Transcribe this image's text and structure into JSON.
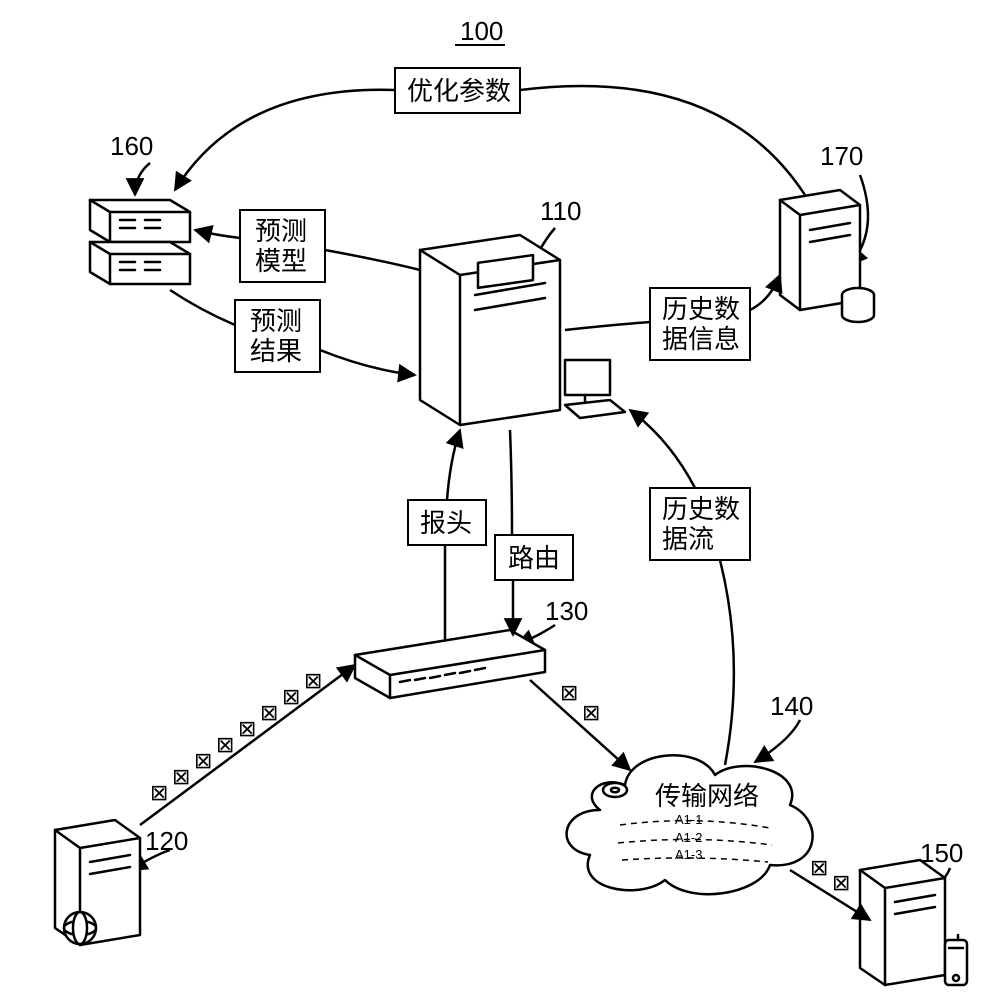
{
  "figure_id": "100",
  "nodes": {
    "n110": {
      "ref": "110"
    },
    "n120": {
      "ref": "120"
    },
    "n130": {
      "ref": "130"
    },
    "n140": {
      "ref": "140",
      "label": "传输网络"
    },
    "n150": {
      "ref": "150"
    },
    "n160": {
      "ref": "160"
    },
    "n170": {
      "ref": "170"
    }
  },
  "edges": {
    "opt_params": {
      "label_l1": "优化参数"
    },
    "pred_model": {
      "label_l1": "预测",
      "label_l2": "模型"
    },
    "pred_result": {
      "label_l1": "预测",
      "label_l2": "结果"
    },
    "hist_data": {
      "label_l1": "历史数",
      "label_l2": "据信息"
    },
    "header": {
      "label_l1": "报头"
    },
    "route": {
      "label_l1": "路由"
    },
    "hist_flow": {
      "label_l1": "历史数",
      "label_l2": "据流"
    }
  },
  "cloud_paths": {
    "p1": "A1-1",
    "p2": "A1-2",
    "p3": "A1-3"
  },
  "packet_glyph": "⊠"
}
